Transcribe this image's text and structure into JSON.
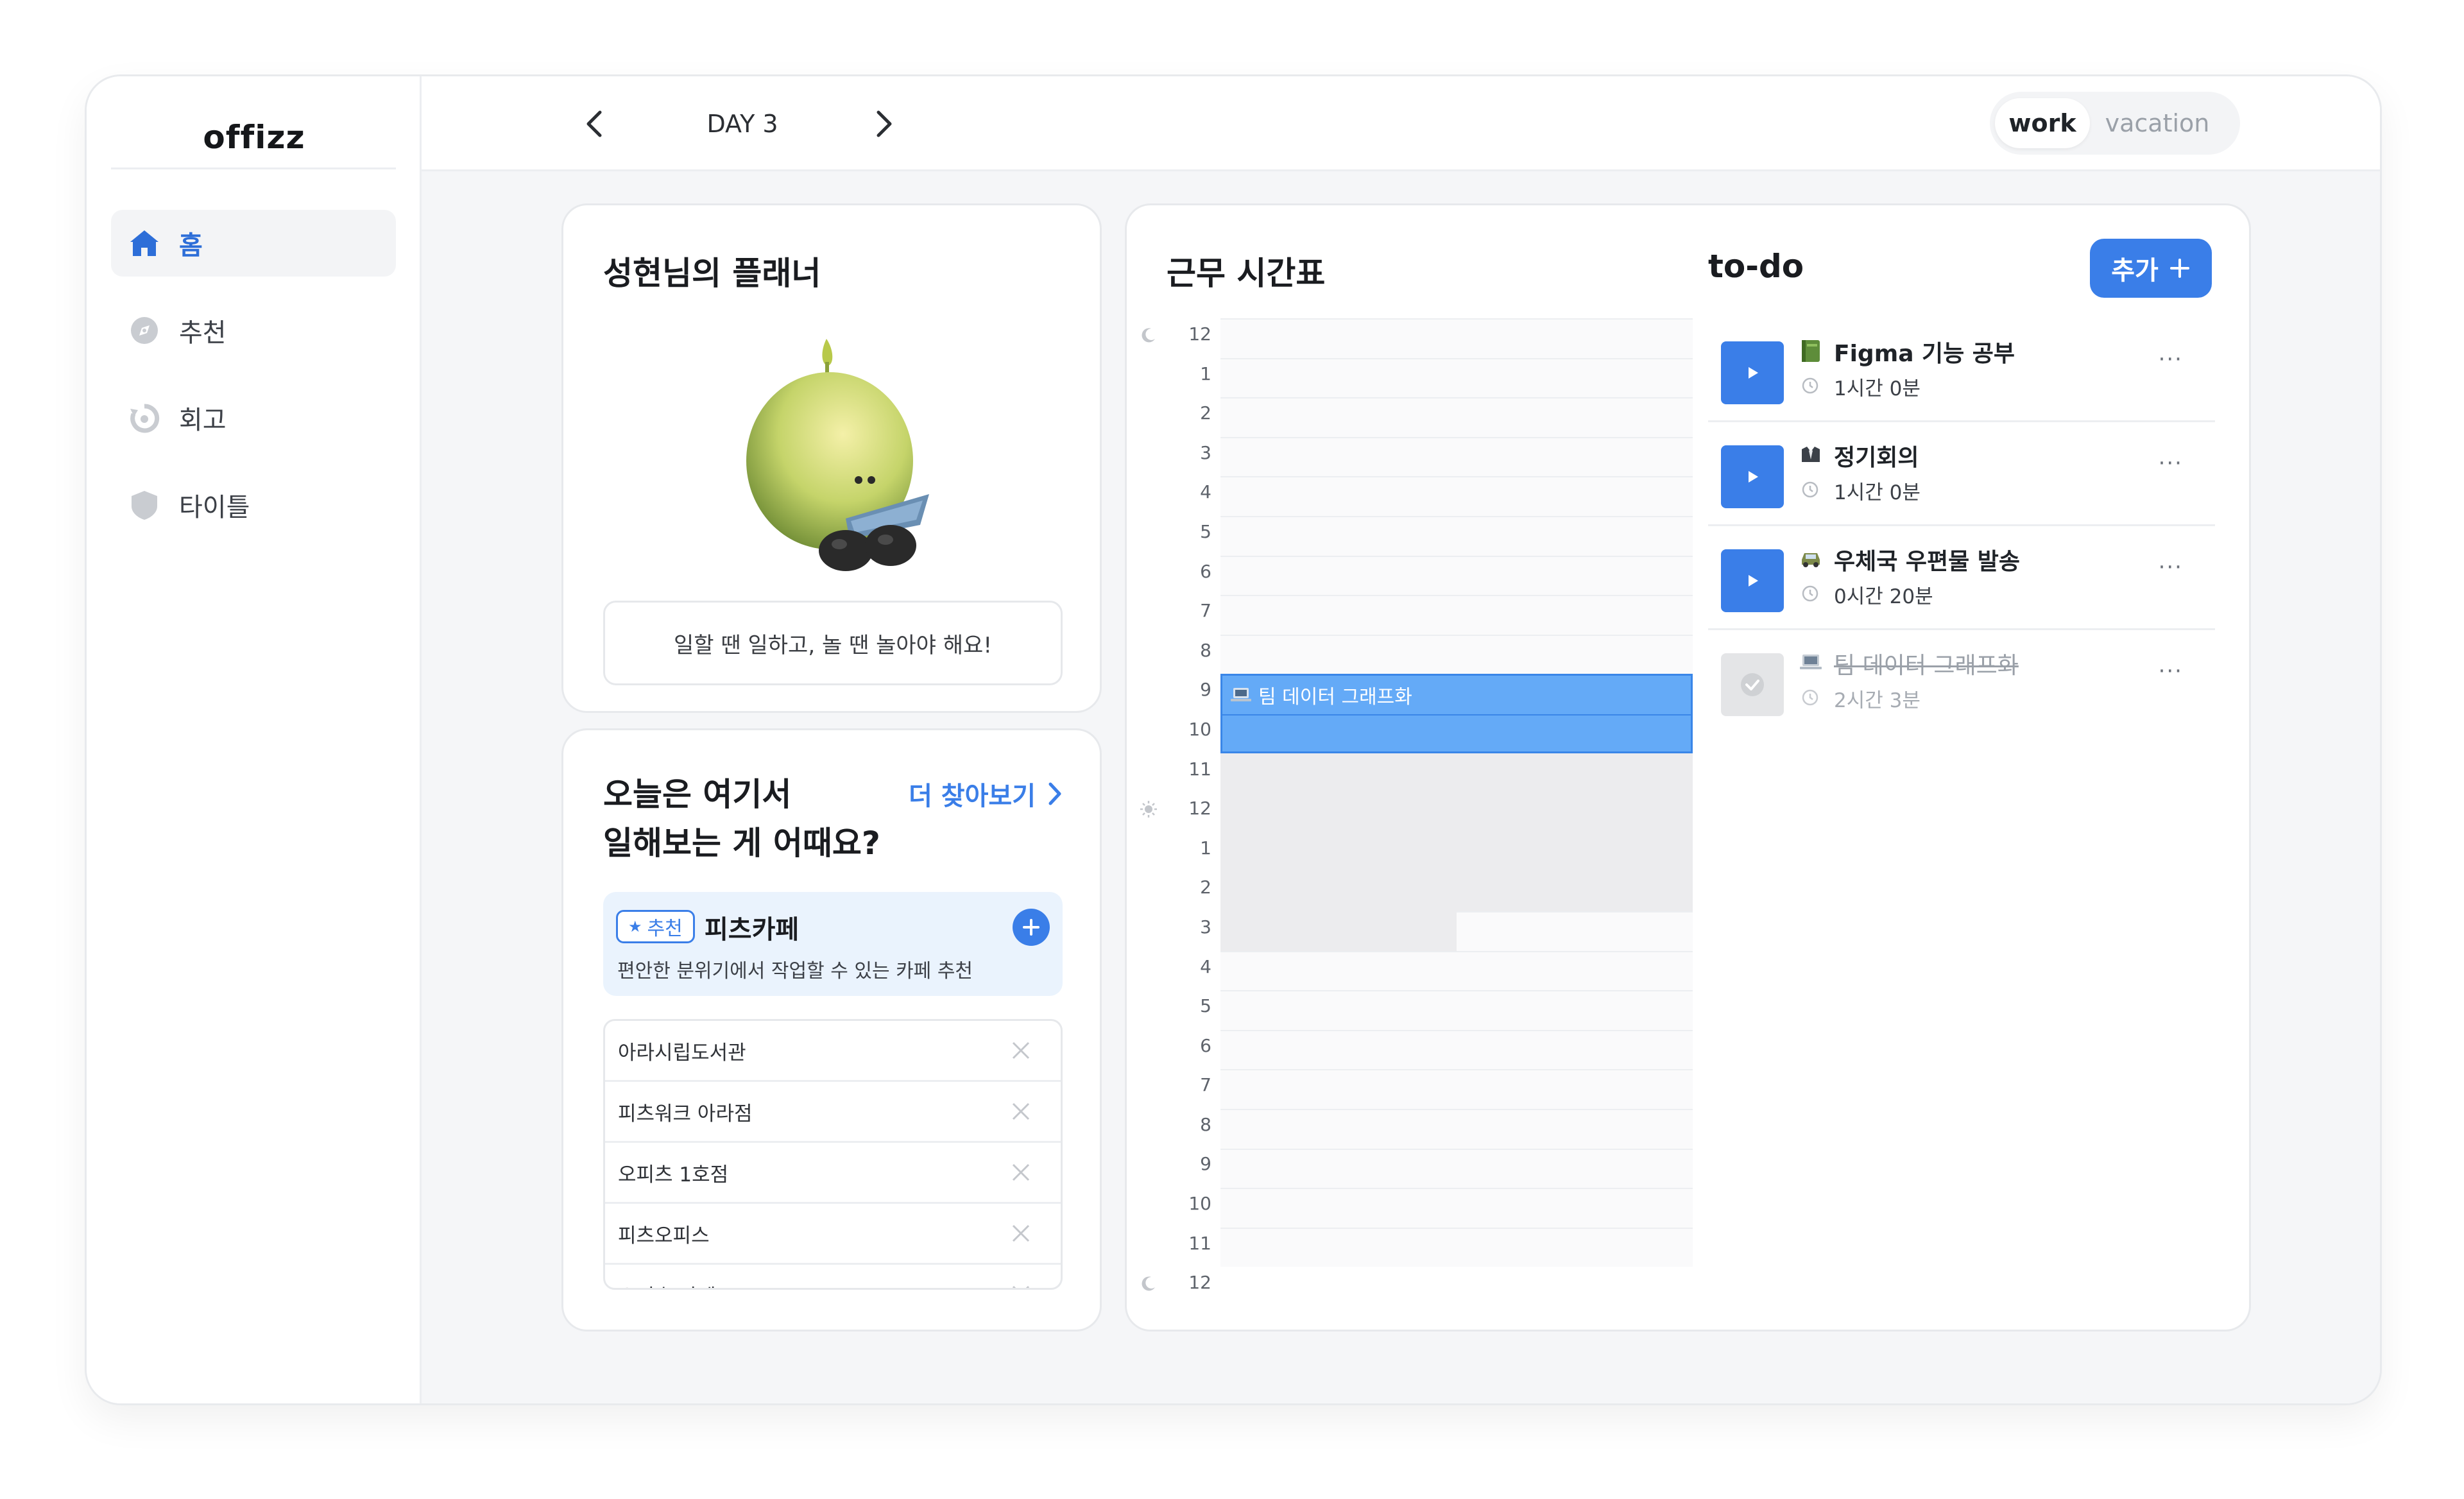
{
  "app": {
    "logo": "offizz"
  },
  "sidebar": {
    "items": [
      {
        "label": "홈",
        "active": true,
        "icon": "home-icon"
      },
      {
        "label": "추천",
        "active": false,
        "icon": "compass-icon"
      },
      {
        "label": "회고",
        "active": false,
        "icon": "history-icon"
      },
      {
        "label": "타이틀",
        "active": false,
        "icon": "badge-icon"
      }
    ]
  },
  "topbar": {
    "day": "DAY 3",
    "modes": [
      "work",
      "vacation"
    ],
    "active_mode": "work"
  },
  "planner": {
    "title": "성현님의 플래너",
    "quote": "일할 땐 일하고, 놀 땐 놀아야 해요!"
  },
  "recommend": {
    "title_line1": "오늘은 여기서",
    "title_line2": "일해보는 게 어때요?",
    "more": "더 찾아보기",
    "badge": "추천",
    "featured_name": "피츠카페",
    "featured_desc": "편안한 분위기에서 작업할 수 있는 카페 추천",
    "places": [
      "아라시립도서관",
      "피츠워크 아라점",
      "오피츠 1호점",
      "피츠오피스",
      "오피츠 카페"
    ]
  },
  "schedule": {
    "title": "근무 시간표",
    "hours": [
      "12",
      "1",
      "2",
      "3",
      "4",
      "5",
      "6",
      "7",
      "8",
      "9",
      "10",
      "11",
      "12",
      "1",
      "2",
      "3",
      "4",
      "5",
      "6",
      "7",
      "8",
      "9",
      "10",
      "11",
      "12"
    ],
    "event_label": "팀 데이터 그래프화"
  },
  "todo": {
    "title": "to-do",
    "add_label": "추가",
    "items": [
      {
        "name": "Figma 기능 공부",
        "duration": "1시간 0분",
        "icon": "book-icon",
        "done": false
      },
      {
        "name": "정기회의",
        "duration": "1시간 0분",
        "icon": "suit-icon",
        "done": false
      },
      {
        "name": "우체국 우편물 발송",
        "duration": "0시간 20분",
        "icon": "car-icon",
        "done": false
      },
      {
        "name": "팀 데이터 그래프화",
        "duration": "2시간 3분",
        "icon": "laptop-icon",
        "done": true
      }
    ],
    "more_label": "···"
  },
  "colors": {
    "accent": "#3a7ee8",
    "event": "#64aaf7",
    "busy": "#ececee"
  }
}
